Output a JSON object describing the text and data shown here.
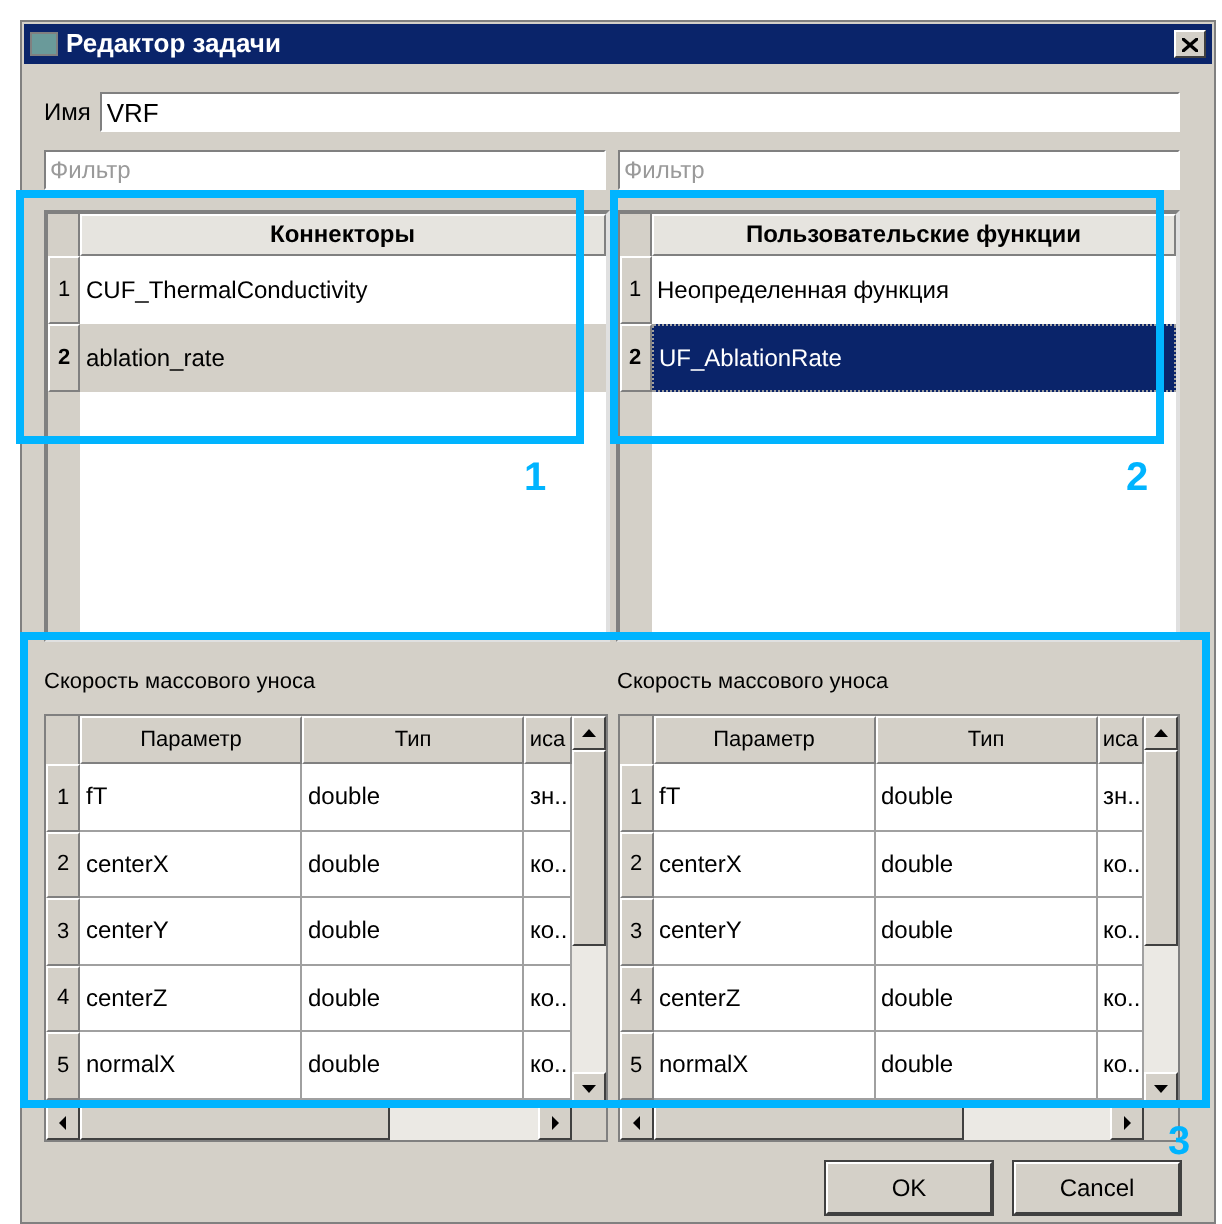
{
  "window": {
    "title": "Редактор задачи"
  },
  "name_field": {
    "label": "Имя",
    "value": "VRF"
  },
  "filters": [
    {
      "placeholder": "Фильтр"
    },
    {
      "placeholder": "Фильтр"
    }
  ],
  "lists": [
    {
      "header": "Коннекторы",
      "focused": false,
      "rows": [
        {
          "number": "1",
          "text": "CUF_ThermalConductivity",
          "selected": false
        },
        {
          "number": "2",
          "text": "ablation_rate",
          "selected": true
        }
      ]
    },
    {
      "header": "Пользовательские функции",
      "focused": true,
      "rows": [
        {
          "number": "1",
          "text": "Неопределенная функция",
          "selected": false
        },
        {
          "number": "2",
          "text": "UF_AblationRate",
          "selected": true
        }
      ]
    }
  ],
  "parameter_tables": [
    {
      "title": "Скорость массового уноса",
      "columns": [
        "Параметр",
        "Тип",
        "иса"
      ],
      "rows": [
        {
          "number": "1",
          "cells": [
            "fT",
            "double",
            "зн.."
          ]
        },
        {
          "number": "2",
          "cells": [
            "centerX",
            "double",
            "ко.."
          ]
        },
        {
          "number": "3",
          "cells": [
            "centerY",
            "double",
            "ко.."
          ]
        },
        {
          "number": "4",
          "cells": [
            "centerZ",
            "double",
            "ко.."
          ]
        },
        {
          "number": "5",
          "cells": [
            "normalX",
            "double",
            "ко.."
          ]
        }
      ]
    },
    {
      "title": "Скорость массового уноса",
      "columns": [
        "Параметр",
        "Тип",
        "иса"
      ],
      "rows": [
        {
          "number": "1",
          "cells": [
            "fT",
            "double",
            "зн.."
          ]
        },
        {
          "number": "2",
          "cells": [
            "centerX",
            "double",
            "ко.."
          ]
        },
        {
          "number": "3",
          "cells": [
            "centerY",
            "double",
            "ко.."
          ]
        },
        {
          "number": "4",
          "cells": [
            "centerZ",
            "double",
            "ко.."
          ]
        },
        {
          "number": "5",
          "cells": [
            "normalX",
            "double",
            "ко.."
          ]
        }
      ]
    }
  ],
  "buttons": [
    {
      "label": "OK"
    },
    {
      "label": "Cancel"
    }
  ],
  "callouts": [
    {
      "label": "1"
    },
    {
      "label": "2"
    },
    {
      "label": "3"
    }
  ]
}
